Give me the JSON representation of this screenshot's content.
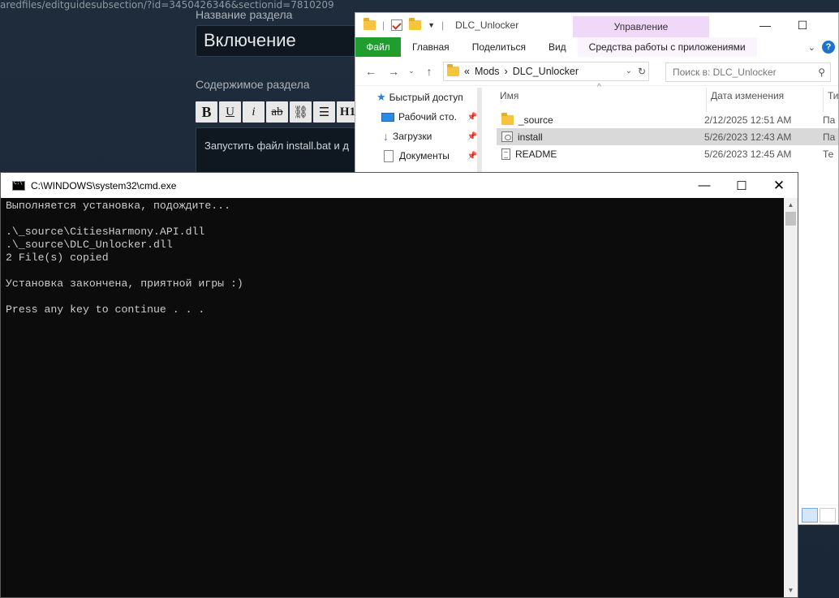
{
  "browser": {
    "url": "aredfiles/editguidesubsection/?id=3450426346&sectionid=7810209"
  },
  "steam_editor": {
    "section_title_label": "Название раздела",
    "section_title_value": "Включение",
    "section_content_label": "Содержимое раздела",
    "format_buttons": [
      "B",
      "U",
      "i",
      "ab",
      "⛓",
      "☰",
      "H1"
    ],
    "content_text": "Запустить файл install.bat и д"
  },
  "explorer": {
    "window_title": "DLC_Unlocker",
    "context_tab": "Управление",
    "ribbon": {
      "file": "Файл",
      "home": "Главная",
      "share": "Поделиться",
      "view": "Вид",
      "app_tools": "Средства работы с приложениями"
    },
    "address": {
      "prefix": "«",
      "parts": [
        "Mods",
        "DLC_Unlocker"
      ],
      "separator": "›"
    },
    "search_placeholder": "Поиск в: DLC_Unlocker",
    "nav": [
      {
        "label": "Быстрый доступ",
        "pinned": false
      },
      {
        "label": "Рабочий сто.",
        "pinned": true
      },
      {
        "label": "Загрузки",
        "pinned": true
      },
      {
        "label": "Документы",
        "pinned": true
      }
    ],
    "columns": {
      "name": "Имя",
      "date": "Дата изменения",
      "type": "Тип"
    },
    "files": [
      {
        "name": "_source",
        "date": "2/12/2025 12:51 AM",
        "type": "Па",
        "icon": "folder-icon"
      },
      {
        "name": "install",
        "date": "5/26/2023 12:43 AM",
        "type": "Па",
        "icon": "batch-file-icon"
      },
      {
        "name": "README",
        "date": "5/26/2023 12:45 AM",
        "type": "Те",
        "icon": "text-file-icon"
      }
    ]
  },
  "cmd": {
    "title": "C:\\WINDOWS\\system32\\cmd.exe",
    "output": "Выполняется установка, подождите...\n\n.\\_source\\CitiesHarmony.API.dll\n.\\_source\\DLC_Unlocker.dll\n2 File(s) copied\n\nУстановка закончена, приятной игры :)\n\nPress any key to continue . . ."
  }
}
